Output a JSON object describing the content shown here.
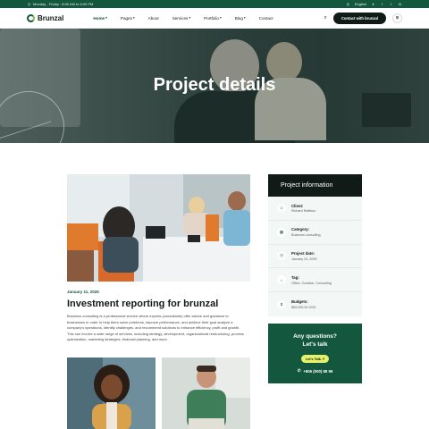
{
  "topbar": {
    "hours": "Monday - Friday : 8:00 AM to 6:00 PM",
    "language": "English",
    "social": [
      "facebook-icon",
      "twitter-icon",
      "instagram-icon"
    ]
  },
  "header": {
    "logo": "Brunzal",
    "nav": [
      {
        "label": "Home",
        "dropdown": true,
        "active": true
      },
      {
        "label": "Pages",
        "dropdown": true
      },
      {
        "label": "About",
        "dropdown": false
      },
      {
        "label": "Services",
        "dropdown": true
      },
      {
        "label": "Portfolio",
        "dropdown": true
      },
      {
        "label": "Blog",
        "dropdown": true
      },
      {
        "label": "Contact",
        "dropdown": false
      }
    ],
    "cta": "Contact with brunzal"
  },
  "hero": {
    "title": "Project details"
  },
  "post": {
    "date": "January 11, 2025",
    "title": "Investment reporting for brunzal",
    "body": "Business consulting is a professional service where experts (consultants) offer advice and guidance to businesses in order to help them solve problems, improve performance, and achieve their goal analyze a company's operations, identify challenges, and recommend solutions to enhance efficiency, profit and growth. This can involve a wide range of services, including strategy, development, organizational restructuring, process optimization, marketing strategies, financial planning, and more."
  },
  "sidebar": {
    "title": "Project information",
    "items": [
      {
        "label": "Client:",
        "value": "Richard Rattison",
        "icon": "user-icon"
      },
      {
        "label": "Category:",
        "value": "Business consulting",
        "icon": "grid-icon"
      },
      {
        "label": "Project date:",
        "value": "January 24, 2025",
        "icon": "clock-icon"
      },
      {
        "label": "Tag:",
        "value": "Office, Creative, Consulting",
        "icon": "tag-icon"
      },
      {
        "label": "Budgets:",
        "value": "$60,000.00 USD",
        "icon": "dollar-icon"
      }
    ],
    "question_title": "Any questions? Let's talk",
    "question_button": "Let's Talk",
    "phone": "+806 (000) 88 99"
  },
  "colors": {
    "brand": "#13573f",
    "dark": "#101a16",
    "accent": "#e4f36a"
  }
}
